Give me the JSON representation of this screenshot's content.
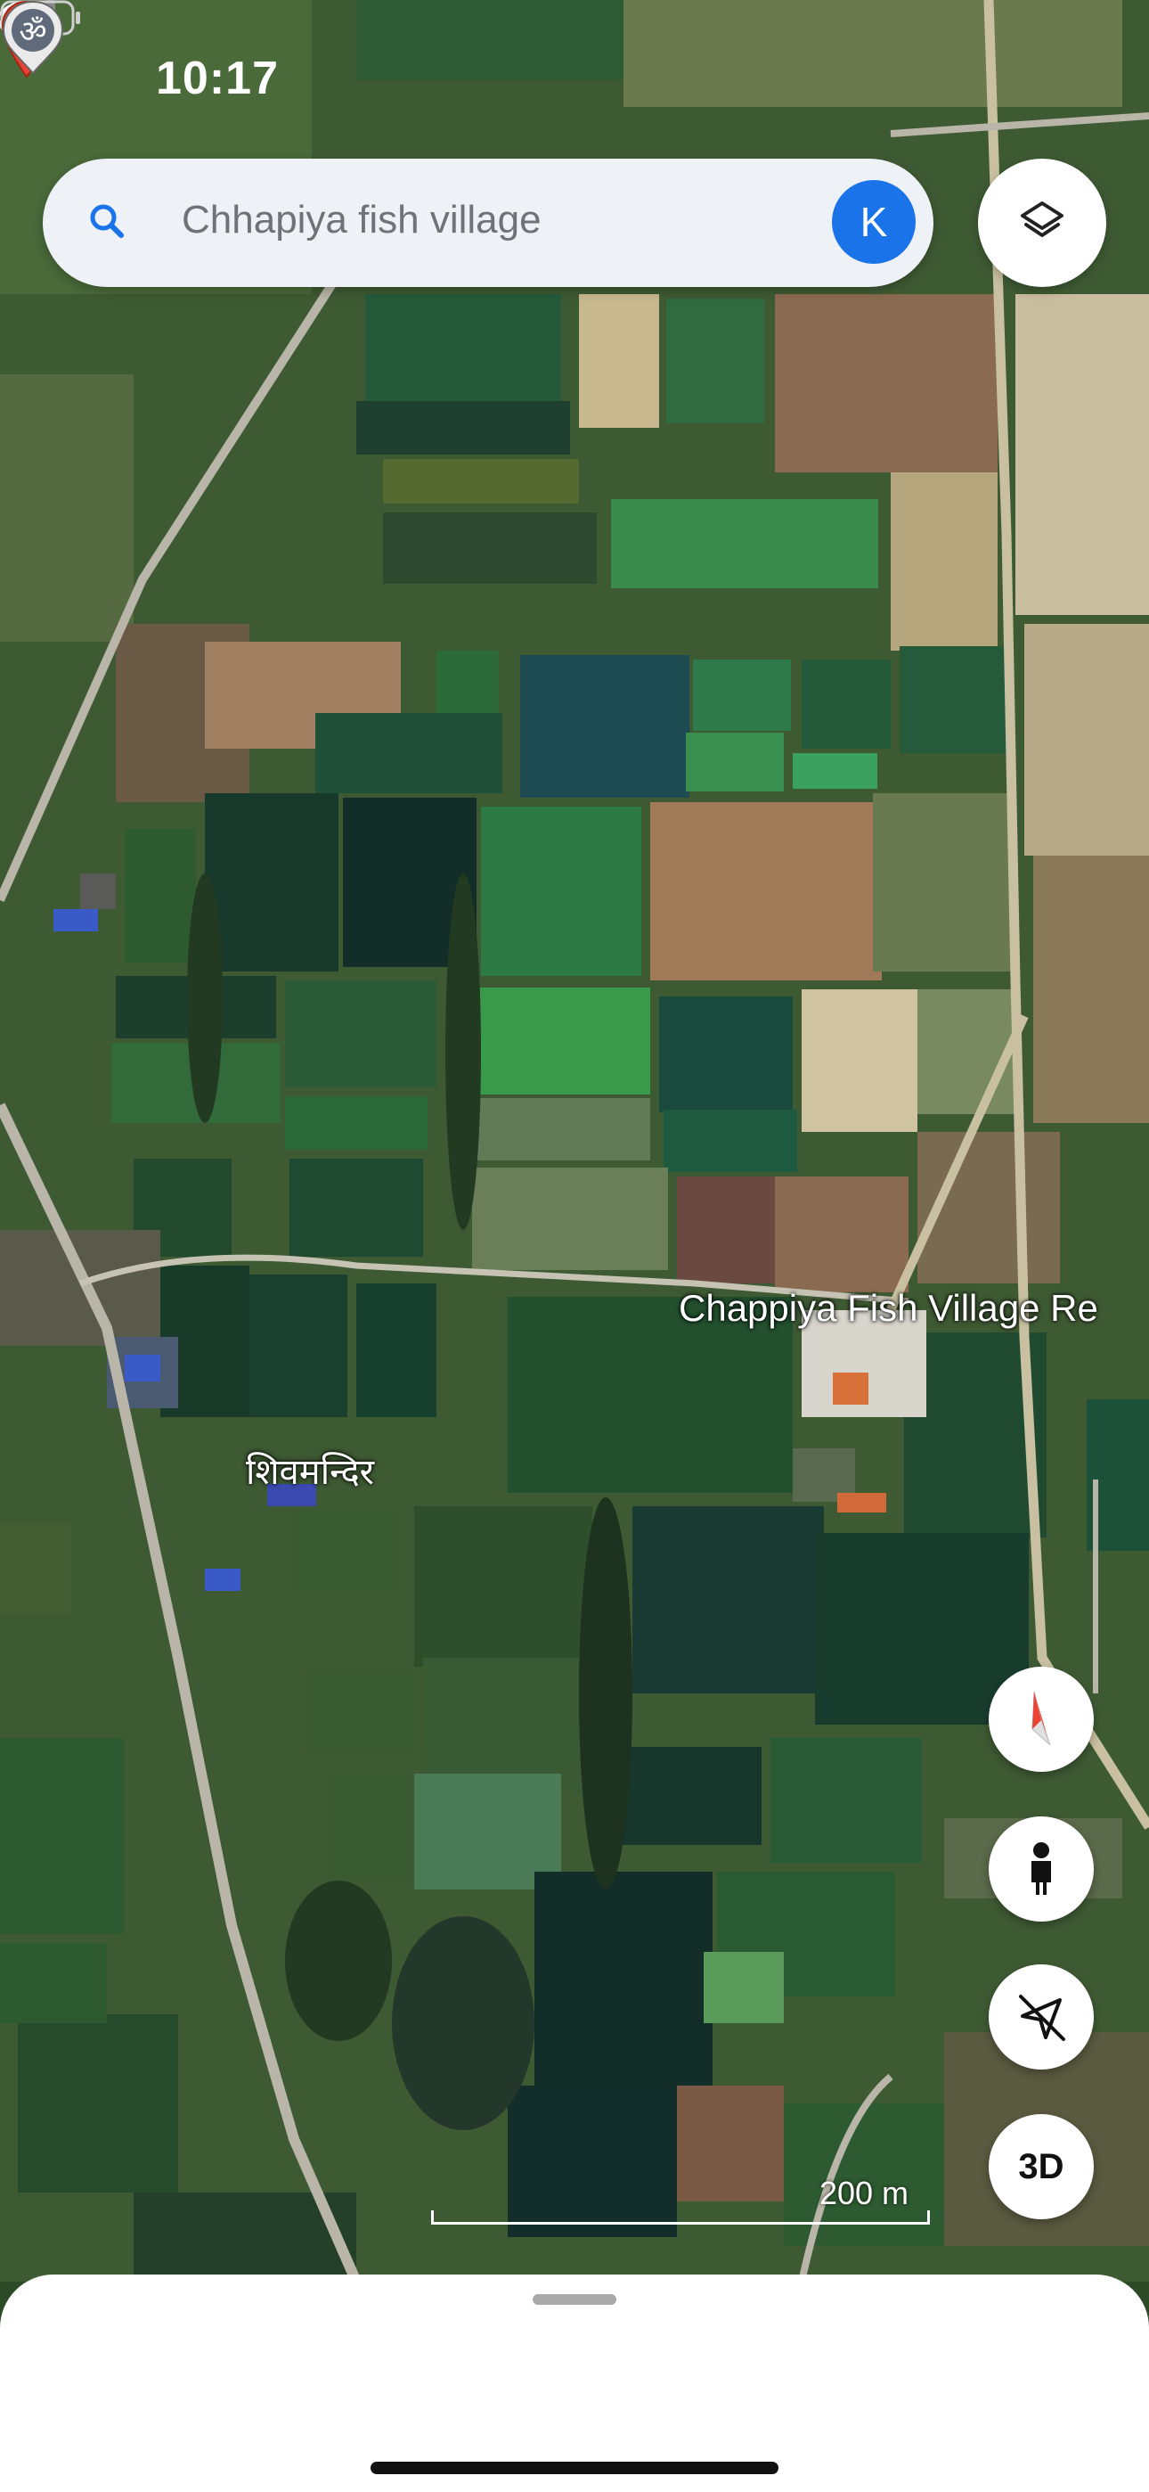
{
  "status_bar": {
    "time": "10:17"
  },
  "search": {
    "query": "Chhapiya fish village",
    "avatar_initial": "K"
  },
  "map": {
    "place_label": "Chappiya Fish Village Re",
    "temple_label": "शिवमन्दिर",
    "temple_icon_glyph": "ॐ",
    "scale_label": "200 m"
  },
  "controls": {
    "three_d_label": "3D"
  },
  "colors": {
    "accent": "#1a73e8",
    "pin": "#ea4335"
  }
}
